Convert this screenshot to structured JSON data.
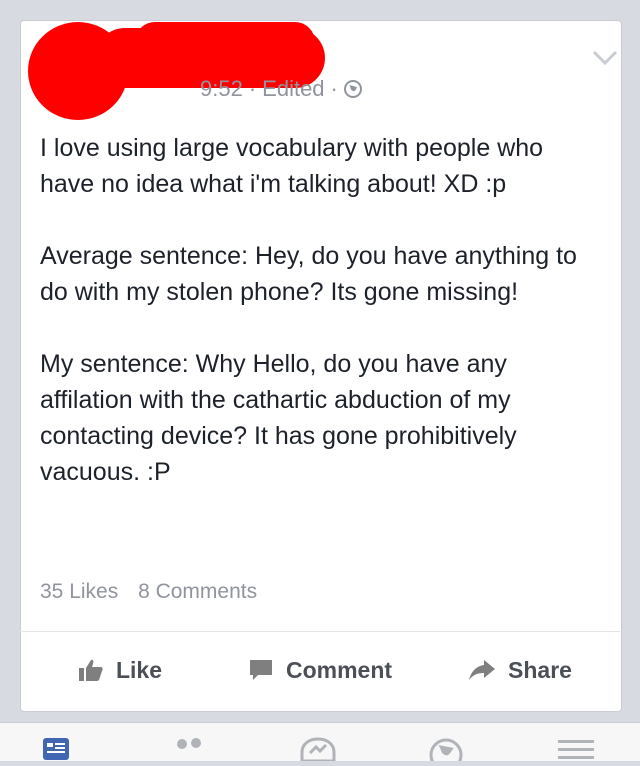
{
  "post": {
    "author": "",
    "timestamp_visible": "9:52",
    "edited_label": "Edited",
    "paragraphs": [
      "I love using large vocabulary with people who have no idea what i'm talking about! XD :p",
      "Average sentence: Hey, do you have anything to do with my stolen phone? Its gone missing!",
      "My sentence: Why Hello, do you have any affilation with the cathartic abduction of my contacting device? It has gone prohibitively vacuous. :P"
    ],
    "likes": "35 Likes",
    "comments": "8 Comments"
  },
  "actions": {
    "like": "Like",
    "comment": "Comment",
    "share": "Share"
  },
  "icons": {
    "privacy": "globe-icon",
    "menu": "chevron-down-icon",
    "like": "thumbs-up-icon",
    "comment": "comment-icon",
    "share": "share-arrow-icon",
    "tabs": [
      "news-feed-icon",
      "friends-icon",
      "messenger-icon",
      "globe-icon",
      "menu-icon"
    ]
  },
  "colors": {
    "redaction": "#ff0000",
    "text": "#1d2129",
    "muted": "#90949c",
    "tab_active": "#4267b2"
  }
}
